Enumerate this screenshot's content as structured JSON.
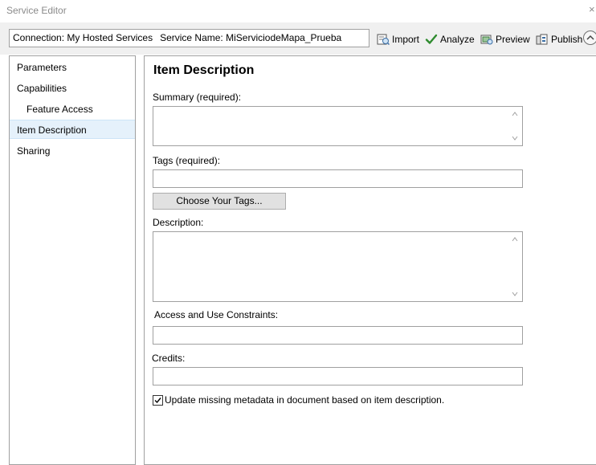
{
  "window": {
    "title": "Service Editor",
    "close_glyph": "×"
  },
  "toolbar": {
    "connection_label": "Connection: My Hosted Services",
    "service_name_label": "Service Name: MiServiciodeMapa_Prueba",
    "import_label": "Import",
    "analyze_label": "Analyze",
    "preview_label": "Preview",
    "publish_label": "Publish"
  },
  "sidebar": {
    "items": [
      {
        "label": "Parameters"
      },
      {
        "label": "Capabilities"
      },
      {
        "label": "Feature Access"
      },
      {
        "label": "Item Description"
      },
      {
        "label": "Sharing"
      }
    ],
    "selected": "Item Description"
  },
  "form": {
    "heading": "Item Description",
    "summary_label": "Summary (required):",
    "summary_value": "",
    "tags_label": "Tags (required):",
    "tags_value": "",
    "choose_tags_label": "Choose Your Tags...",
    "description_label": "Description:",
    "description_value": "",
    "access_label": "Access and Use Constraints:",
    "access_value": "",
    "credits_label": "Credits:",
    "credits_value": "",
    "update_metadata_label": "Update missing metadata in document based on item description.",
    "update_metadata_checked": true
  },
  "icons": {
    "import": "import-icon",
    "analyze": "checkmark-icon",
    "preview": "preview-icon",
    "publish": "publish-icon",
    "collapse": "chevron-up-icon"
  },
  "colors": {
    "toolbar_bg": "#f0f0f0",
    "selected_item_bg": "#e5f1fb",
    "analyze_green": "#2e8b2e"
  }
}
